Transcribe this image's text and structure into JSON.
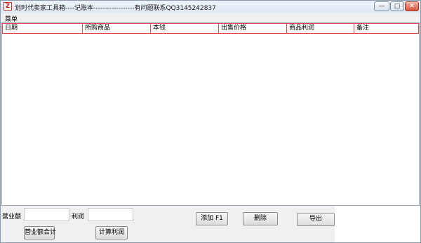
{
  "window": {
    "title": "划时代卖家工具箱----记账本------------------有问题联系QQ3145242837",
    "icon_text": "Z",
    "minimize_glyph": "—",
    "maximize_glyph": "□",
    "close_glyph": "✕"
  },
  "menu": {
    "items": [
      "菜单"
    ]
  },
  "table": {
    "columns": [
      "日期",
      "所购商品",
      "本钱",
      "出售价格",
      "商品利润",
      "备注"
    ],
    "rows": []
  },
  "form": {
    "revenue_label": "营业额",
    "revenue_value": "",
    "profit_label": "利润",
    "profit_value": "",
    "revenue_total_button": "营业额合计",
    "calc_profit_button": "计算利润",
    "add_button": "添加 F1",
    "delete_button": "删除",
    "export_button": "导出"
  }
}
